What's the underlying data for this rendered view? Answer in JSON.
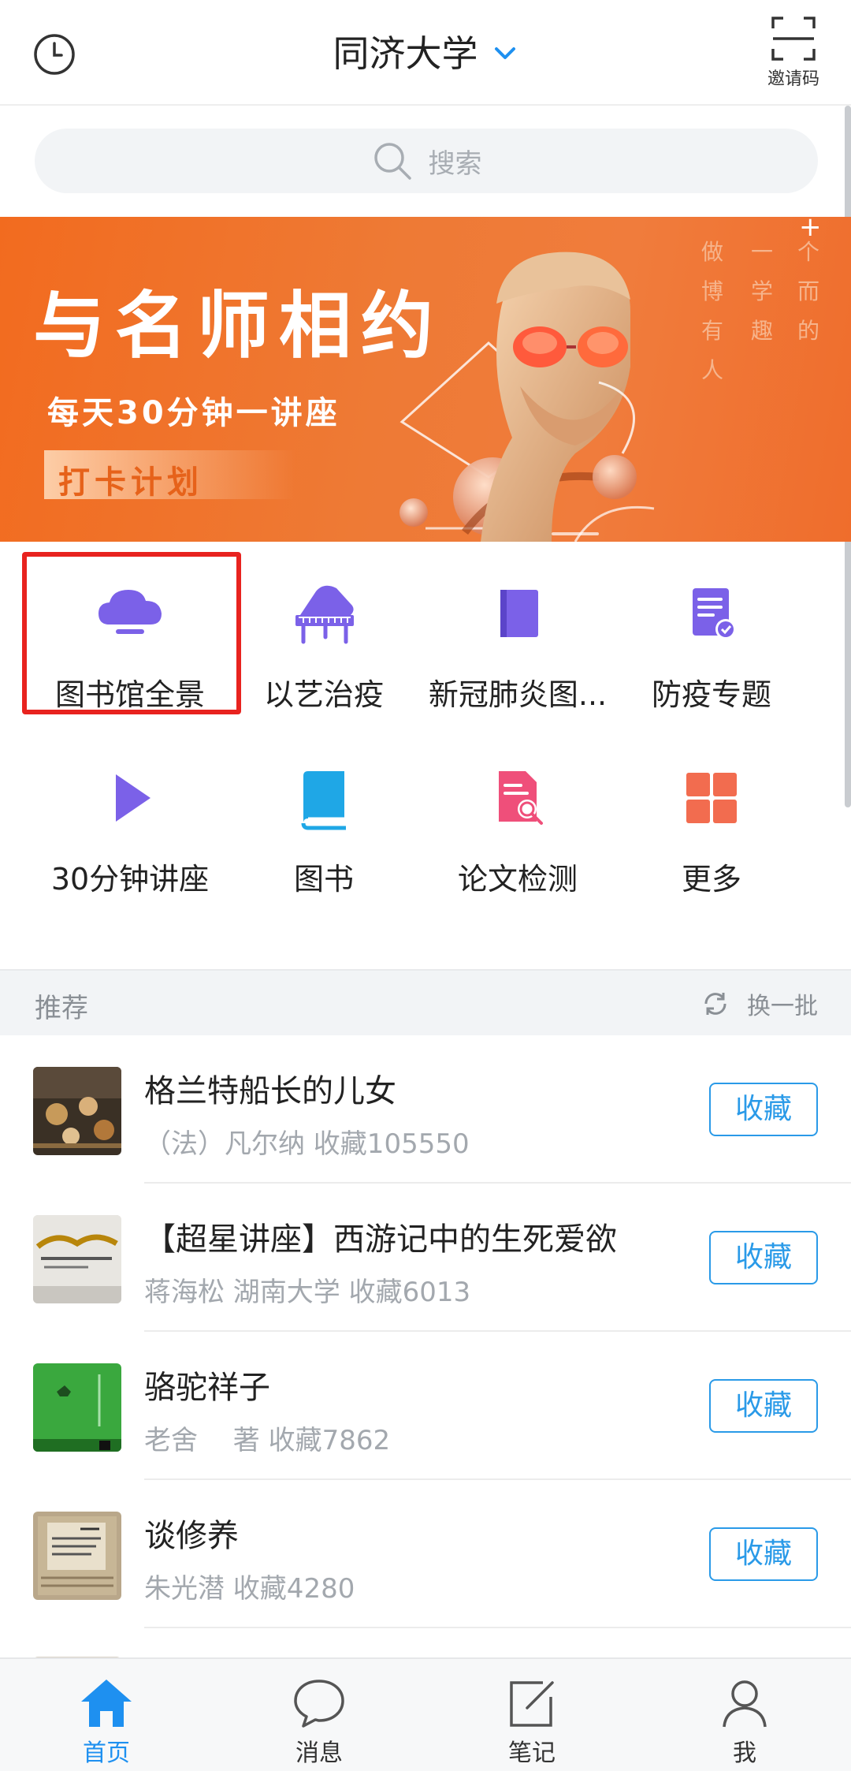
{
  "header": {
    "title": "同济大学",
    "scan_label": "邀请码"
  },
  "search": {
    "placeholder": "搜索"
  },
  "banner": {
    "title": "与名师相约",
    "subtitle": "每天30分钟一讲座",
    "tag": "打卡计划",
    "side_col1": [
      "做",
      "博",
      "有",
      "人"
    ],
    "side_col2": [
      "一",
      "学",
      "趣",
      ""
    ],
    "side_col3": [
      "个",
      "而",
      "的",
      ""
    ],
    "side_plus": "+"
  },
  "grid": {
    "items": [
      {
        "label": "图书馆全景",
        "icon": "library-panorama-icon",
        "color": "#7b61e8"
      },
      {
        "label": "以艺治疫",
        "icon": "piano-icon",
        "color": "#7b61e8"
      },
      {
        "label": "新冠肺炎图...",
        "icon": "book-icon",
        "color": "#7b61e8"
      },
      {
        "label": "防疫专题",
        "icon": "document-icon",
        "color": "#7b61e8"
      },
      {
        "label": "30分钟讲座",
        "icon": "play-icon",
        "color": "#7b61e8"
      },
      {
        "label": "图书",
        "icon": "book-open-icon",
        "color": "#1fa7e6"
      },
      {
        "label": "论文检测",
        "icon": "paper-check-icon",
        "color": "#ef4f7a"
      },
      {
        "label": "更多",
        "icon": "grid-more-icon",
        "color": "#f26c4f"
      }
    ]
  },
  "recommend": {
    "title": "推荐",
    "refresh_label": "换一批",
    "items": [
      {
        "title": "格兰特船长的儿女",
        "subtitle": "（法）凡尔纳 收藏105550",
        "button": "收藏"
      },
      {
        "title": "【超星讲座】西游记中的生死爱欲",
        "subtitle": "蒋海松 湖南大学 收藏6013",
        "button": "收藏"
      },
      {
        "title": "骆驼祥子",
        "subtitle": "老舍　 著 收藏7862",
        "button": "收藏"
      },
      {
        "title": "谈修养",
        "subtitle": "朱光潜 收藏4280",
        "button": "收藏"
      }
    ]
  },
  "tabbar": {
    "items": [
      {
        "label": "首页",
        "active": true
      },
      {
        "label": "消息",
        "active": false
      },
      {
        "label": "笔记",
        "active": false
      },
      {
        "label": "我",
        "active": false
      }
    ]
  },
  "colors": {
    "accent": "#1e90f0",
    "banner": "#f26b1f",
    "highlight": "#e8231f",
    "icon_purple": "#7b61e8"
  }
}
